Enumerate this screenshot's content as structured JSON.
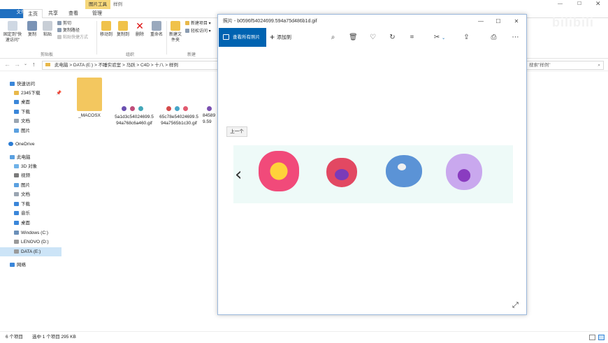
{
  "explorer": {
    "ribbon_tabs": [
      "文件",
      "主页",
      "共享",
      "查看",
      "管理"
    ],
    "context_tab_group": "图片工具",
    "path_tail": "样例",
    "ribbon": {
      "pin_label": "固定到\"快速访问\"",
      "copy_label": "复制",
      "paste_label": "粘贴",
      "cut_label": "剪切",
      "copy_path_label": "复制路径",
      "paste_shortcut_label": "粘贴快捷方式",
      "clipboard_group": "剪贴板",
      "move_to_label": "移动到",
      "copy_to_label": "复制到",
      "delete_label": "删除",
      "rename_label": "重命名",
      "organize_group": "组织",
      "new_folder_label": "新建文件夹",
      "new_item_label": "新建项目",
      "easy_access_label": "轻松访问",
      "new_group": "新建"
    },
    "breadcrumb": [
      "此电脑",
      "DATA (E:)",
      "不睡实验室",
      "马跃",
      "C4D",
      "十八",
      "样例"
    ],
    "search_placeholder": "搜索\"样例\"",
    "nav": {
      "quick_access": "快速访问",
      "items": [
        "2345下载",
        "桌面",
        "下载",
        "文档",
        "图片"
      ],
      "onedrive": "OneDrive",
      "this_pc": "此电脑",
      "pc_items": [
        "3D 对象",
        "视频",
        "图片",
        "文档",
        "下载",
        "音乐",
        "桌面",
        "Windows (C:)",
        "LENOVO (D:)",
        "DATA (E:)"
      ],
      "network": "网络"
    },
    "files": [
      {
        "name": "_MACOSX"
      },
      {
        "name": "5a1d3c54024699.594a768c6a460.gif"
      },
      {
        "name": "65c78e54024699.594a7565b1c30.gif"
      },
      {
        "name": "845899.59"
      }
    ],
    "status": {
      "count": "6 个项目",
      "selection": "选中 1 个项目 295 KB"
    }
  },
  "viewer": {
    "app": "照片",
    "filename": "b0596f54024699.594a75d486b1d.gif",
    "see_all_label": "查看所有照片",
    "add_to_label": "添加到",
    "prev_label": "上一个",
    "colors": {
      "accent": "#0063b1"
    }
  },
  "watermark": "bilibili"
}
